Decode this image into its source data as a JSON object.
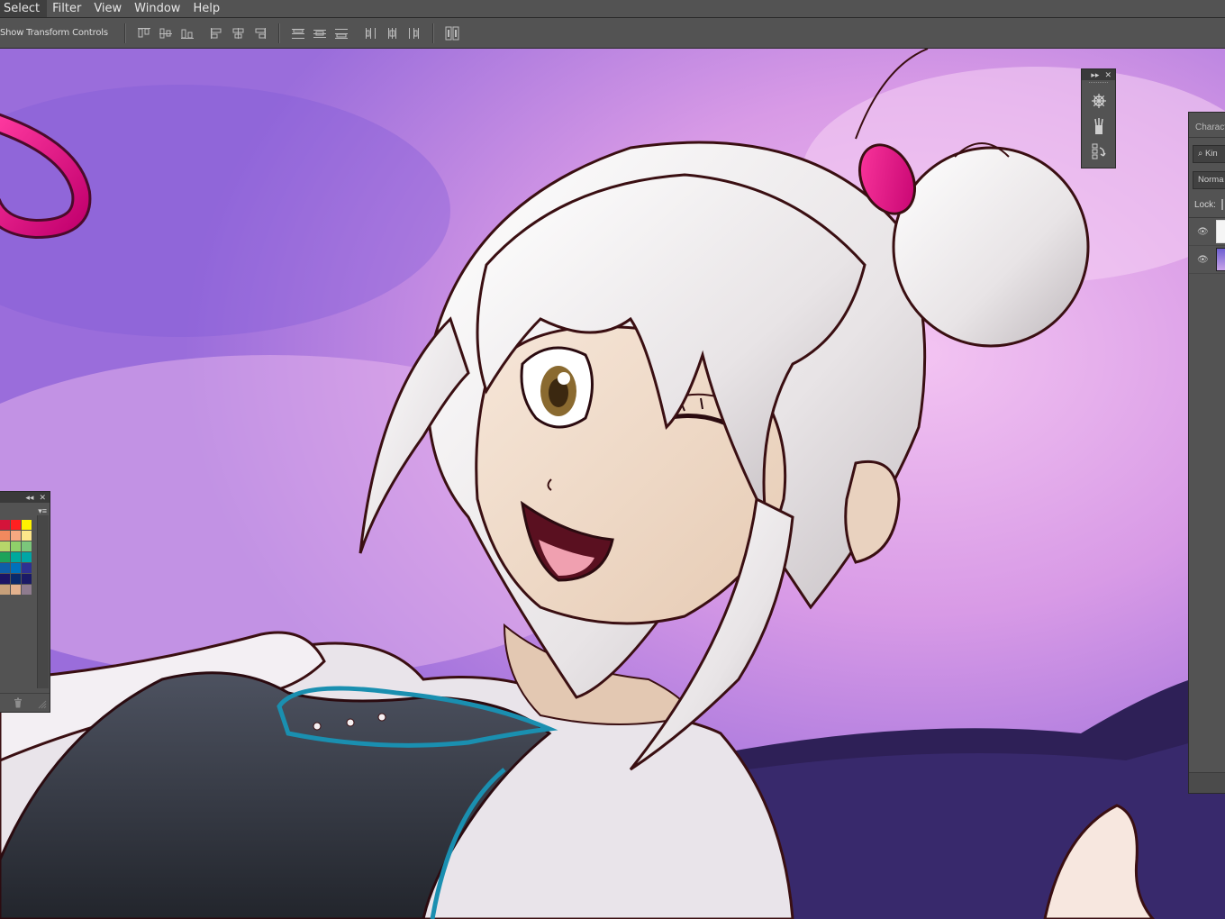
{
  "menubar": {
    "items": [
      {
        "label": "Select"
      },
      {
        "label": "Filter"
      },
      {
        "label": "View"
      },
      {
        "label": "Window"
      },
      {
        "label": "Help"
      }
    ]
  },
  "options_bar": {
    "transform_label": "Show Transform Controls",
    "align_icons": [
      "align-top-edges-icon",
      "align-vertical-centers-icon",
      "align-bottom-edges-icon",
      "align-left-edges-icon",
      "align-horizontal-centers-icon",
      "align-right-edges-icon",
      "distribute-top-edges-icon",
      "distribute-vertical-centers-icon",
      "distribute-bottom-edges-icon",
      "distribute-left-edges-icon",
      "distribute-horizontal-centers-icon",
      "distribute-right-edges-icon",
      "auto-align-layers-icon"
    ]
  },
  "swatches_panel": {
    "colors": [
      "#d4143a",
      "#ff2020",
      "#fff200",
      "#f2895e",
      "#f7a981",
      "#fde68a",
      "#b7d66a",
      "#8fd06a",
      "#7bc67b",
      "#1da35a",
      "#00a99d",
      "#00a6a6",
      "#0e5ea8",
      "#0071bc",
      "#2e3192",
      "#1b1464",
      "#0a2a6b",
      "#1a1a66",
      "#c7a07a",
      "#e3b28e",
      "#8e7b8e"
    ]
  },
  "layers_panel": {
    "tab_label": "Charact",
    "search_text": "Kin",
    "blend_mode": "Norma",
    "lock_label": "Lock:"
  }
}
